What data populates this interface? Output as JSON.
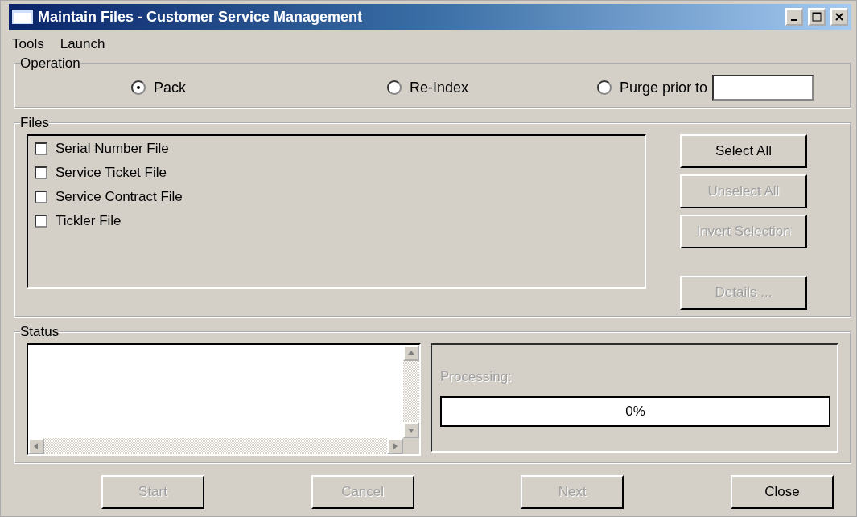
{
  "window": {
    "title": "Maintain Files - Customer Service Management"
  },
  "menu": [
    "Tools",
    "Launch"
  ],
  "operation": {
    "label": "Operation",
    "options": [
      {
        "label": "Pack",
        "selected": true
      },
      {
        "label": "Re-Index",
        "selected": false
      },
      {
        "label": "Purge prior to",
        "selected": false
      }
    ]
  },
  "files": {
    "label": "Files",
    "items": [
      {
        "label": "Serial Number File",
        "checked": false
      },
      {
        "label": "Service Ticket File",
        "checked": false
      },
      {
        "label": "Service Contract File",
        "checked": false
      },
      {
        "label": "Tickler File",
        "checked": false
      }
    ],
    "buttons": [
      {
        "label": "Select All",
        "disabled": false
      },
      {
        "label": "Unselect All",
        "disabled": true
      },
      {
        "label": "Invert Selection",
        "disabled": true
      },
      {
        "label": "Details ...",
        "disabled": true
      }
    ]
  },
  "status": {
    "label": "Status",
    "processing_label": "Processing:",
    "progress": {
      "level": 0,
      "reading": "0%"
    }
  },
  "buttons": [
    {
      "label": "Start",
      "disabled": true
    },
    {
      "label": "Cancel",
      "disabled": true
    },
    {
      "label": "Next",
      "disabled": true
    },
    {
      "label": "Close",
      "disabled": false
    }
  ]
}
